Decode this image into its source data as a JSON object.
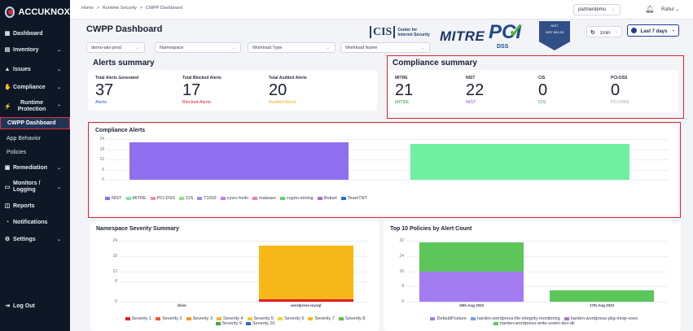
{
  "app": {
    "logo_text": "ACCUKNOX"
  },
  "sidebar": {
    "items": [
      {
        "label": "Dashboard",
        "icon": "grid-icon",
        "glyph": "▦",
        "chevron": ""
      },
      {
        "label": "Inventory",
        "icon": "inventory-icon",
        "glyph": "▤",
        "chevron": "⌄"
      },
      {
        "label": "Issues",
        "icon": "warning-icon",
        "glyph": "▲",
        "chevron": "⌄"
      },
      {
        "label": "Compliance",
        "icon": "hand-icon",
        "glyph": "✋",
        "chevron": "⌄"
      },
      {
        "label": "Runtime Protection",
        "icon": "runtime-icon",
        "glyph": "⚡",
        "chevron": "⌃"
      }
    ],
    "sub_items": [
      "CWPP Dashboard",
      "App Behavior",
      "Policies"
    ],
    "items2": [
      {
        "label": "Remediation",
        "icon": "remediation-icon",
        "glyph": "▣",
        "chevron": "⌄"
      },
      {
        "label": "Monitors / Logging",
        "icon": "monitor-icon",
        "glyph": "▭",
        "chevron": "⌄"
      },
      {
        "label": "Reports",
        "icon": "reports-icon",
        "glyph": "◫",
        "chevron": ""
      },
      {
        "label": "Notifications",
        "icon": "bell-icon",
        "glyph": "◔",
        "chevron": ""
      },
      {
        "label": "Settings",
        "icon": "gear-icon",
        "glyph": "⚙",
        "chevron": "⌄"
      }
    ],
    "logout": "Log Out",
    "logout_icon": "logout-icon"
  },
  "topbar": {
    "breadcrumb": [
      "Home",
      ">",
      "Runtime Security",
      ">",
      "CWPP Dashboard"
    ],
    "workspace": "partnerdemo",
    "user": "Rahul"
  },
  "header": {
    "title": "CWPP Dashboard",
    "filters": {
      "cluster": "demo-aks-prod",
      "namespace": "Namespace",
      "workload_type": "Workload Type",
      "workload_name": "Workload Name"
    },
    "refresh": "1min",
    "range": "Last 7 days",
    "logos": {
      "cis_mark": "CIS",
      "cis_text1": "Center for",
      "cis_text2": "Internet Security",
      "mitre": "MITRE",
      "pci": "PCI",
      "pci_dss": "DSS",
      "nist": "NIST",
      "nist_sub": "NIST 800-53"
    }
  },
  "alerts_summary": {
    "title": "Alerts summary",
    "stats": [
      {
        "label": "Total Alerts Generated",
        "value": "37",
        "sub": "Alerts",
        "color": "#1d5fd6"
      },
      {
        "label": "Total Blocked Alerts",
        "value": "17",
        "sub": "Blocked Alerts",
        "color": "#e0232e"
      },
      {
        "label": "Total Audited Alerts",
        "value": "20",
        "sub": "Audited Alerts",
        "color": "#f1b322"
      }
    ]
  },
  "compliance_summary": {
    "title": "Compliance summary",
    "stats": [
      {
        "label": "MITRE",
        "value": "21",
        "sub": "MITRE",
        "color": "#2f9c47"
      },
      {
        "label": "NIST",
        "value": "22",
        "sub": "NIST",
        "color": "#8a55e0"
      },
      {
        "label": "CIS",
        "value": "0",
        "sub": "CIS",
        "color": "#2f9c47"
      },
      {
        "label": "PCI-DSS",
        "value": "0",
        "sub": "PCI-DSS",
        "color": "#9aa0ad"
      }
    ]
  },
  "compliance_alerts": {
    "title": "Compliance Alerts",
    "y_ticks": [
      "24",
      "18",
      "12",
      "6",
      "0"
    ],
    "legend": [
      {
        "name": "NIST",
        "color": "#8f6ff0"
      },
      {
        "name": "MITRE",
        "color": "#6fefa0"
      },
      {
        "name": "PCI-DSS",
        "color": "#f08fb4"
      },
      {
        "name": "CIS",
        "color": "#8fe07a"
      },
      {
        "name": "T1003",
        "color": "#9b8cf2"
      },
      {
        "name": "cysrv-hello",
        "color": "#c97be6"
      },
      {
        "name": "malware",
        "color": "#e77fb8"
      },
      {
        "name": "crypto-mining",
        "color": "#62d06a"
      },
      {
        "name": "Botnet",
        "color": "#b06acb"
      },
      {
        "name": "TeamTNT",
        "color": "#2b6ce0"
      }
    ]
  },
  "namespace_severity": {
    "title": "Namespace Severity Summary",
    "y_ticks": [
      "24",
      "18",
      "12",
      "8",
      "0"
    ],
    "legend": [
      {
        "name": "Severity 1",
        "color": "#e21f2b"
      },
      {
        "name": "Severity 2",
        "color": "#f05a2a"
      },
      {
        "name": "Severity 3",
        "color": "#f7991f"
      },
      {
        "name": "Severity 4",
        "color": "#f5b22a"
      },
      {
        "name": "Severity 5",
        "color": "#f6c533"
      },
      {
        "name": "Severity 6",
        "color": "#f3d13e"
      },
      {
        "name": "Severity 7",
        "color": "#f6b919"
      },
      {
        "name": "Severity 8",
        "color": "#62c046"
      },
      {
        "name": "Severity 9",
        "color": "#44a63a"
      },
      {
        "name": "Severity 10",
        "color": "#2c67d8"
      }
    ]
  },
  "top_policies": {
    "title": "Top 10 Policies by Alert Count",
    "y_ticks": [
      "32",
      "24",
      "16",
      "8",
      "0"
    ],
    "legend": [
      {
        "name": "DefaultPosture",
        "color": "#a27cf0"
      },
      {
        "name": "harden-wordpress-file-integrity-monitoring",
        "color": "#6da6e8"
      },
      {
        "name": "harden-wordpress-pkg-mngr-exec",
        "color": "#b070d0"
      },
      {
        "name": "harden-wordpress-write-under-dev-dir",
        "color": "#5cc65a"
      }
    ]
  },
  "chart_data": [
    {
      "type": "bar",
      "title": "Compliance Alerts",
      "categories": [
        "NIST",
        "MITRE"
      ],
      "values": [
        22,
        21
      ],
      "colors": [
        "#8f6ff0",
        "#6fefa0"
      ],
      "ylim": [
        0,
        24
      ]
    },
    {
      "type": "bar",
      "title": "Namespace Severity Summary",
      "categories": [
        "drive",
        "wordpress-mysql"
      ],
      "series": [
        {
          "name": "Severity 1",
          "values": [
            0,
            1
          ]
        },
        {
          "name": "Severity 7",
          "values": [
            0,
            21
          ]
        }
      ],
      "ylim": [
        0,
        24
      ]
    },
    {
      "type": "bar",
      "title": "Top 10 Policies by Alert Count",
      "categories": [
        "18th Aug 2023",
        "17th Aug 2023"
      ],
      "series": [
        {
          "name": "DefaultPosture",
          "values": [
            16,
            0
          ]
        },
        {
          "name": "harden-wordpress-write-under-dev-dir",
          "values": [
            15,
            6
          ]
        }
      ],
      "ylim": [
        0,
        32
      ]
    }
  ]
}
